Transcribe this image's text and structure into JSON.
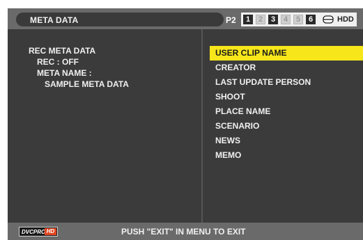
{
  "header": {
    "title": "META DATA",
    "media_label": "P2",
    "slots": [
      {
        "label": "1",
        "active": true
      },
      {
        "label": "2",
        "active": false
      },
      {
        "label": "3",
        "active": true
      },
      {
        "label": "4",
        "active": false
      },
      {
        "label": "5",
        "active": false
      },
      {
        "label": "6",
        "active": true
      }
    ],
    "drive_icon": "hdd-icon",
    "drive_label": "HDD"
  },
  "info": {
    "rec_meta_data": "REC META DATA",
    "rec_status": "REC : OFF",
    "meta_name": "META NAME :",
    "meta_name_value": "SAMPLE META DATA"
  },
  "menu": {
    "items": [
      {
        "label": "USER CLIP NAME",
        "selected": true
      },
      {
        "label": "CREATOR",
        "selected": false
      },
      {
        "label": "LAST UPDATE PERSON",
        "selected": false
      },
      {
        "label": "SHOOT",
        "selected": false
      },
      {
        "label": "PLACE NAME",
        "selected": false
      },
      {
        "label": "SCENARIO",
        "selected": false
      },
      {
        "label": "NEWS",
        "selected": false
      },
      {
        "label": "MEMO",
        "selected": false
      }
    ]
  },
  "footer": {
    "logo_text": "DVCPRO",
    "logo_badge": "HD",
    "message": "PUSH \"EXIT\" IN MENU TO EXIT"
  },
  "colors": {
    "selection": "#f6e61a",
    "logo_badge": "#e2451f",
    "panel": "#3b3b3b",
    "bars": "#6a6a6a"
  }
}
